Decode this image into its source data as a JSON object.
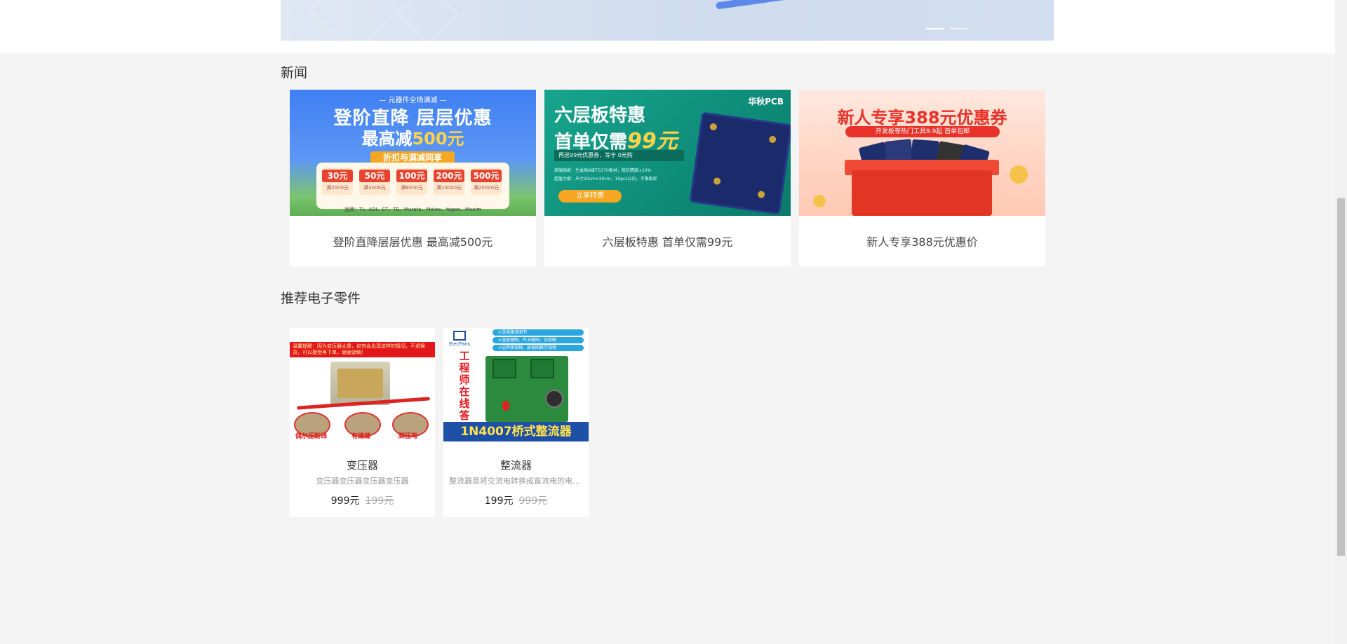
{
  "sections": {
    "news_title": "新闻",
    "recommend_title": "推荐电子零件"
  },
  "news": [
    {
      "caption": "登阶直降层层优惠 最高减500元",
      "banner": {
        "tag": "— 元器件全场满减 —",
        "line1": "登阶直降 层层优惠",
        "line2_prefix": "最高减",
        "line2_highlight": "500元",
        "ribbon": "折扣与满减同享",
        "coupons": [
          {
            "value": "30元",
            "cond": "满2000元"
          },
          {
            "value": "50元",
            "cond": "满3000元"
          },
          {
            "value": "100元",
            "cond": "满6000元"
          },
          {
            "value": "200元",
            "cond": "满10000元"
          },
          {
            "value": "500元",
            "cond": "满20000元"
          }
        ],
        "brands": "品牌：TI、ADI、ST、TE、Murata、Molex、Yageo、Maxim"
      }
    },
    {
      "caption": "六层板特惠 首单仅需99元",
      "banner": {
        "logo": "华秋PCB",
        "line1": "六层板特惠",
        "line2_prefix": "首单仅需",
        "line2_highlight": "99元",
        "strip": "再送99元优惠券，等于 0元购",
        "detail1": "高端高配：生益高A级TG170板材，阻抗精度±10%",
        "detail2": "超值力度：尺寸20cm×20cm，10pcs以内，不限板厚",
        "button": "立享特惠"
      }
    },
    {
      "caption": "新人专享388元优惠价",
      "banner": {
        "line1": "新人专享388元优惠券",
        "pill": "开发板等热门工具9.9起  首单包邮"
      }
    }
  ],
  "products": [
    {
      "name": "变压器",
      "desc": "变压器变压器变压器变压器",
      "price": "999元",
      "old_price": "199元",
      "image": {
        "warning": "温馨提醒：因为变压器太重，如有会出现这样的情况，不退换货，可以接受再下单，谢谢谅解！",
        "labels": [
          "偶尔压断线",
          "有缝缝",
          "脚压弯"
        ]
      }
    },
    {
      "name": "整流器",
      "desc": "整流器是将交流电转换成直流电的电子器件",
      "price": "199元",
      "old_price": "999元",
      "image": {
        "logo": "ElecFans",
        "chips": [
          "✔送电路说明书",
          "✔送原理图、PCB截图、仿真图",
          "✔送焊接视频、原理图教学视频"
        ],
        "vertical": "工程师在线答疑",
        "bar": "1N4007桥式整流器"
      }
    }
  ],
  "carousel": {
    "slides": 2,
    "active": 0
  },
  "colors": {
    "page_bg": "#f4f4f4",
    "card_bg": "#ffffff",
    "price_old": "#aaaaaa"
  }
}
